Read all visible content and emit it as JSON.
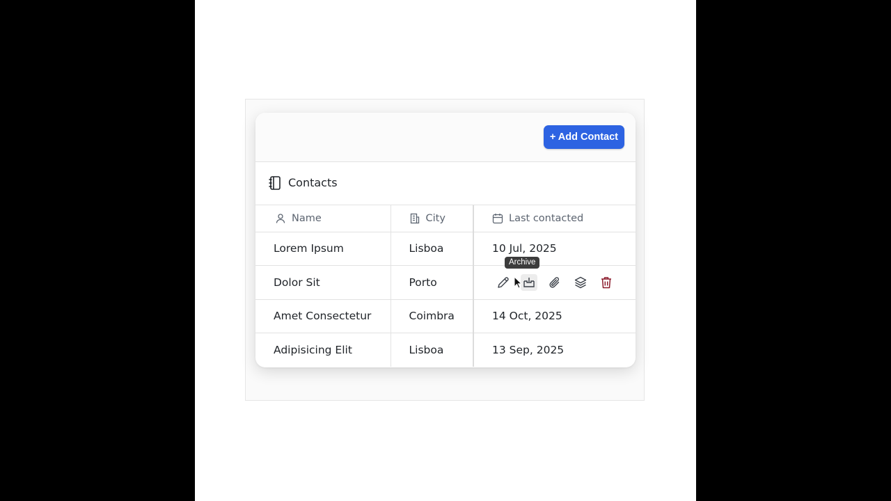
{
  "toolbar": {
    "add_contact_label": "+ Add Contact"
  },
  "panel": {
    "title": "Contacts",
    "icon": "notebook-icon"
  },
  "table": {
    "columns": [
      {
        "label": "Name",
        "icon": "user-icon"
      },
      {
        "label": "City",
        "icon": "building-icon"
      },
      {
        "label": "Last contacted",
        "icon": "calendar-icon"
      }
    ],
    "rows": [
      {
        "name": "Lorem Ipsum",
        "city": "Lisboa",
        "last_contacted": "10 Jul, 2025"
      },
      {
        "name": "Dolor Sit",
        "city": "Porto",
        "last_contacted": ""
      },
      {
        "name": "Amet Consectetur",
        "city": "Coimbra",
        "last_contacted": "14 Oct, 2025"
      },
      {
        "name": "Adipisicing Elit",
        "city": "Lisboa",
        "last_contacted": "13 Sep, 2025"
      }
    ],
    "row_actions": [
      "pencil-icon",
      "archive-icon",
      "paperclip-icon",
      "layers-icon",
      "trash-icon"
    ]
  },
  "tooltip": {
    "text": "Archive"
  },
  "colors": {
    "accent": "#2d63e2",
    "danger": "#8b1a2b"
  }
}
